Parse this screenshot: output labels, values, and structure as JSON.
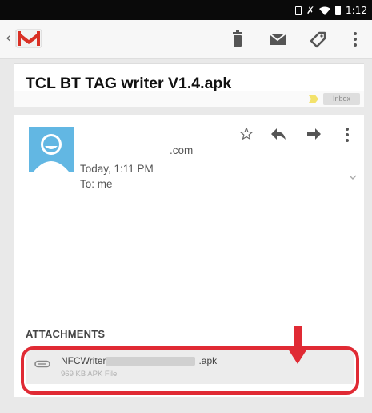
{
  "status_bar": {
    "time": "1:12"
  },
  "action_bar": {
    "app_logo": "gmail-logo",
    "actions": [
      {
        "icon": "delete-icon"
      },
      {
        "icon": "mark-unread-icon"
      },
      {
        "icon": "label-icon"
      },
      {
        "icon": "overflow-menu-icon"
      }
    ]
  },
  "subject": {
    "text": "TCL BT TAG writer V1.4.apk",
    "label": "Inbox"
  },
  "message": {
    "sender": ".com",
    "date": "Today, 1:11 PM",
    "to": "To: me",
    "actions": [
      {
        "icon": "star-icon"
      },
      {
        "icon": "reply-icon"
      },
      {
        "icon": "forward-icon"
      },
      {
        "icon": "overflow-menu-icon"
      }
    ]
  },
  "attachments": {
    "heading": "ATTACHMENTS",
    "items": [
      {
        "name_start": "NFCWriter",
        "name_end": ".apk",
        "meta": "969 KB APK File",
        "icon": "paperclip-icon"
      }
    ]
  },
  "colors": {
    "highlight": "#e02a34",
    "avatar": "#62b7e3",
    "accent": "#d93025"
  }
}
